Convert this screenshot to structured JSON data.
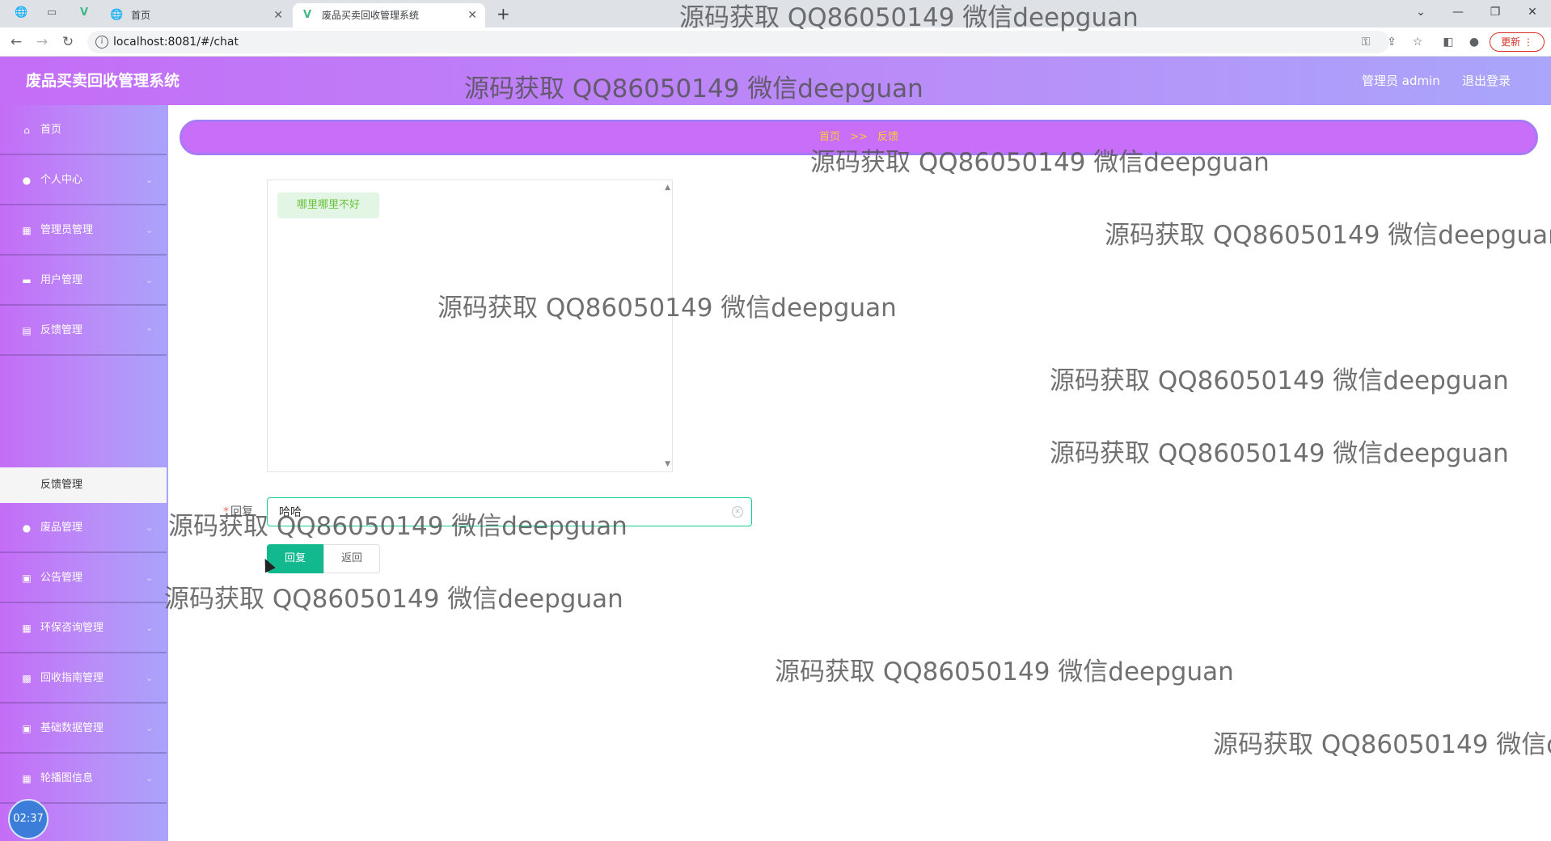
{
  "browser": {
    "inactive_tab_title": "首页",
    "active_tab_title": "废品买卖回收管理系统",
    "new_tab": "+",
    "url": "localhost:8081/#/chat",
    "update_button": "更新"
  },
  "header": {
    "title": "废品买卖回收管理系统",
    "user": "管理员 admin",
    "logout": "退出登录"
  },
  "sidebar": {
    "items": [
      {
        "label": "首页",
        "icon": "home-icon"
      },
      {
        "label": "个人中心",
        "icon": "user-icon"
      },
      {
        "label": "管理员管理",
        "icon": "grid-icon"
      },
      {
        "label": "用户管理",
        "icon": "chat-icon"
      },
      {
        "label": "反馈管理",
        "icon": "briefcase-icon"
      },
      {
        "label": "废品管理",
        "icon": "location-icon"
      },
      {
        "label": "公告管理",
        "icon": "clipboard-icon"
      },
      {
        "label": "环保咨询管理",
        "icon": "grid-icon"
      },
      {
        "label": "回收指南管理",
        "icon": "film-icon"
      },
      {
        "label": "基础数据管理",
        "icon": "clipboard-icon"
      },
      {
        "label": "轮播图信息",
        "icon": "grid-icon"
      }
    ],
    "submenu_active": "反馈管理",
    "clock": "02:37"
  },
  "breadcrumb": {
    "home": "首页",
    "separator": ">>",
    "current": "反馈"
  },
  "chat": {
    "messages": [
      "哪里哪里不好"
    ]
  },
  "form": {
    "reply_label": "回复",
    "required_mark": "*",
    "reply_value": "哈哈",
    "submit_button": "回复",
    "back_button": "返回"
  },
  "watermark": "源码获取 QQ86050149 微信deepguan"
}
